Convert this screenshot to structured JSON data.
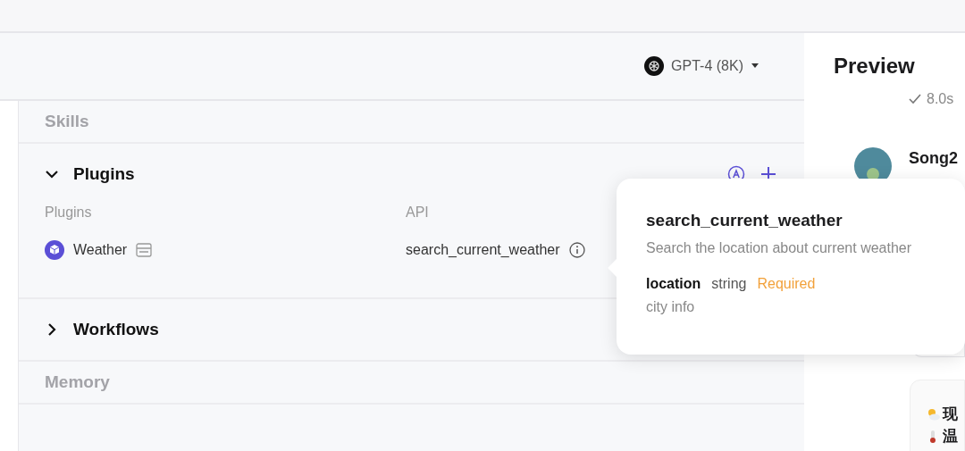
{
  "header": {
    "model": {
      "name": "GPT-4 (8K)"
    }
  },
  "skills": {
    "heading": "Skills",
    "sections": [
      {
        "title": "Plugins",
        "expanded": true,
        "columns": [
          "Plugins",
          "API"
        ],
        "rows": [
          {
            "plugin": "Weather",
            "api": "search_current_weather"
          }
        ]
      },
      {
        "title": "Workflows",
        "expanded": false
      }
    ]
  },
  "memory": {
    "heading": "Memory"
  },
  "tooltip": {
    "title": "search_current_weather",
    "description": "Search the location about current weather",
    "params": [
      {
        "name": "location",
        "type": "string",
        "required_label": "Required",
        "description": "city info"
      }
    ]
  },
  "preview": {
    "title": "Preview",
    "status": "8.0s",
    "message": {
      "author": "Song2"
    },
    "card_lines": [
      {
        "kind": "weather",
        "text": "现"
      },
      {
        "kind": "temperature",
        "text": "温"
      }
    ]
  }
}
